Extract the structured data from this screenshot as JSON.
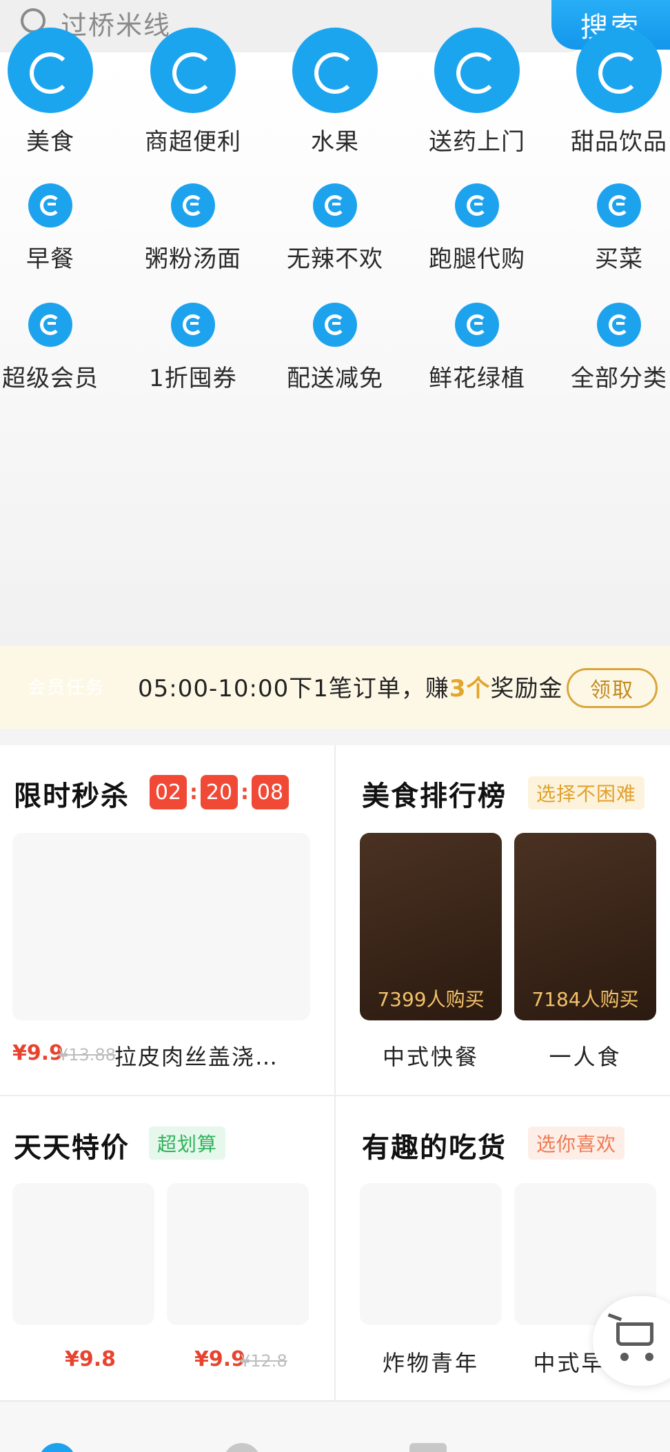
{
  "search": {
    "placeholder": "过桥米线",
    "button_label": "搜索",
    "icon": "search-icon"
  },
  "colors": {
    "brand_blue": "#1da3ee",
    "timer_red": "#f04a36",
    "gold": "#e3a52b"
  },
  "categories": [
    {
      "label": "美食",
      "icon": "eleme-icon"
    },
    {
      "label": "商超便利",
      "icon": "eleme-icon"
    },
    {
      "label": "水果",
      "icon": "eleme-icon"
    },
    {
      "label": "送药上门",
      "icon": "eleme-icon"
    },
    {
      "label": "甜品饮品",
      "icon": "eleme-icon"
    },
    {
      "label": "早餐",
      "icon": "eleme-icon"
    },
    {
      "label": "粥粉汤面",
      "icon": "eleme-icon"
    },
    {
      "label": "无辣不欢",
      "icon": "eleme-icon"
    },
    {
      "label": "跑腿代购",
      "icon": "eleme-icon"
    },
    {
      "label": "买菜",
      "icon": "eleme-icon"
    },
    {
      "label": "超级会员",
      "icon": "eleme-icon"
    },
    {
      "label": "1折囤券",
      "icon": "eleme-icon"
    },
    {
      "label": "配送减免",
      "icon": "eleme-icon"
    },
    {
      "label": "鲜花绿植",
      "icon": "eleme-icon"
    },
    {
      "label": "全部分类",
      "icon": "eleme-icon"
    }
  ],
  "member_task": {
    "tag": "会员任务",
    "text_prefix": "05:00-10:00下1笔订单，赚",
    "highlight": "3个",
    "text_suffix": "奖励金",
    "button_label": "领取"
  },
  "flash_sale": {
    "title": "限时秒杀",
    "timer": [
      "02",
      "20",
      "08"
    ],
    "timer_sep": ":",
    "item": {
      "price": "¥9.9",
      "original_price": "¥13.88",
      "name": "拉皮肉丝盖浇…"
    }
  },
  "food_ranking": {
    "title": "美食排行榜",
    "badge": "选择不困难",
    "items": [
      {
        "buyers": "7399人购买",
        "name": "中式快餐"
      },
      {
        "buyers": "7184人购买",
        "name": "一人食"
      }
    ]
  },
  "daily_deals": {
    "title": "天天特价",
    "badge": "超划算",
    "items": [
      {
        "price": "¥9.8",
        "original_price": ""
      },
      {
        "price": "¥9.9",
        "original_price": "¥12.8"
      }
    ]
  },
  "foodie": {
    "title": "有趣的吃货",
    "badge": "选你喜欢",
    "items": [
      {
        "name": "炸物青年"
      },
      {
        "name": "中式早"
      }
    ]
  },
  "cart": {
    "icon": "cart-icon"
  }
}
